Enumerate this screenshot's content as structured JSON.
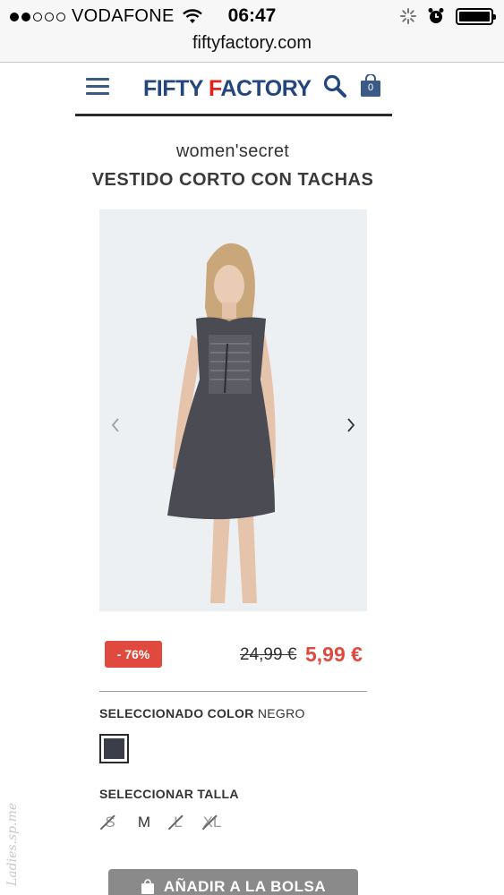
{
  "status_bar": {
    "carrier": "VODAFONE",
    "time": "06:47",
    "signal_bars_filled": 2,
    "signal_bars_total": 5
  },
  "browser": {
    "url": "fiftyfactory.com"
  },
  "header": {
    "logo_part1": "FIFTY ",
    "logo_part2": "F",
    "logo_part3": "ACTORY",
    "bag_count": "0"
  },
  "product": {
    "brand": "women'secret",
    "title": "VESTIDO CORTO CON TACHAS",
    "discount": "- 76%",
    "old_price": "24,99 €",
    "new_price": "5,99 €"
  },
  "options": {
    "color_label": "SELECCIONADO COLOR",
    "color_value": "NEGRO",
    "size_label": "SELECCIONAR TALLA",
    "sizes": [
      {
        "label": "S",
        "available": false
      },
      {
        "label": "M",
        "available": true
      },
      {
        "label": "L",
        "available": false
      },
      {
        "label": "XL",
        "available": false
      }
    ]
  },
  "cta": {
    "add_to_bag": "AÑADIR A LA BOLSA"
  },
  "watermark": "Ladies.sp.me",
  "colors": {
    "brand_blue": "#24467e",
    "brand_red": "#e2231a",
    "price_red": "#e0493e",
    "swatch": "#3b3d48"
  }
}
